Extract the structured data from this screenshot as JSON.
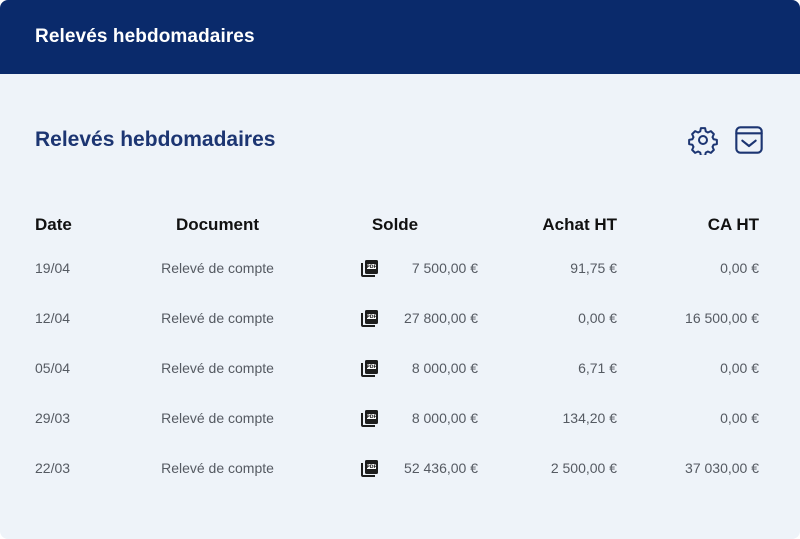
{
  "header": {
    "title": "Relevés hebdomadaires"
  },
  "section": {
    "title": "Relevés hebdomadaires",
    "actions": [
      {
        "name": "settings",
        "icon": "gear-icon"
      },
      {
        "name": "download",
        "icon": "download-box-icon"
      }
    ]
  },
  "colors": {
    "topbar": "#0a2a6b",
    "title": "#1c3572",
    "card_bg": "#eef3f9"
  },
  "table": {
    "columns": [
      "Date",
      "Document",
      "Solde",
      "Achat HT",
      "CA HT"
    ],
    "rows": [
      {
        "date": "19/04",
        "document": "Relevé de compte",
        "doc_icon": "pdf-icon",
        "solde": "7 500,00 €",
        "achat_ht": "91,75 €",
        "ca_ht": "0,00 €"
      },
      {
        "date": "12/04",
        "document": "Relevé de compte",
        "doc_icon": "pdf-icon",
        "solde": "27 800,00 €",
        "achat_ht": "0,00 €",
        "ca_ht": "16 500,00 €"
      },
      {
        "date": "05/04",
        "document": "Relevé de compte",
        "doc_icon": "pdf-icon",
        "solde": "8 000,00 €",
        "achat_ht": "6,71 €",
        "ca_ht": "0,00 €"
      },
      {
        "date": "29/03",
        "document": "Relevé de compte",
        "doc_icon": "pdf-icon",
        "solde": "8 000,00 €",
        "achat_ht": "134,20 €",
        "ca_ht": "0,00 €"
      },
      {
        "date": "22/03",
        "document": "Relevé de compte",
        "doc_icon": "pdf-icon",
        "solde": "52 436,00 €",
        "achat_ht": "2 500,00 €",
        "ca_ht": "37 030,00 €"
      }
    ]
  }
}
